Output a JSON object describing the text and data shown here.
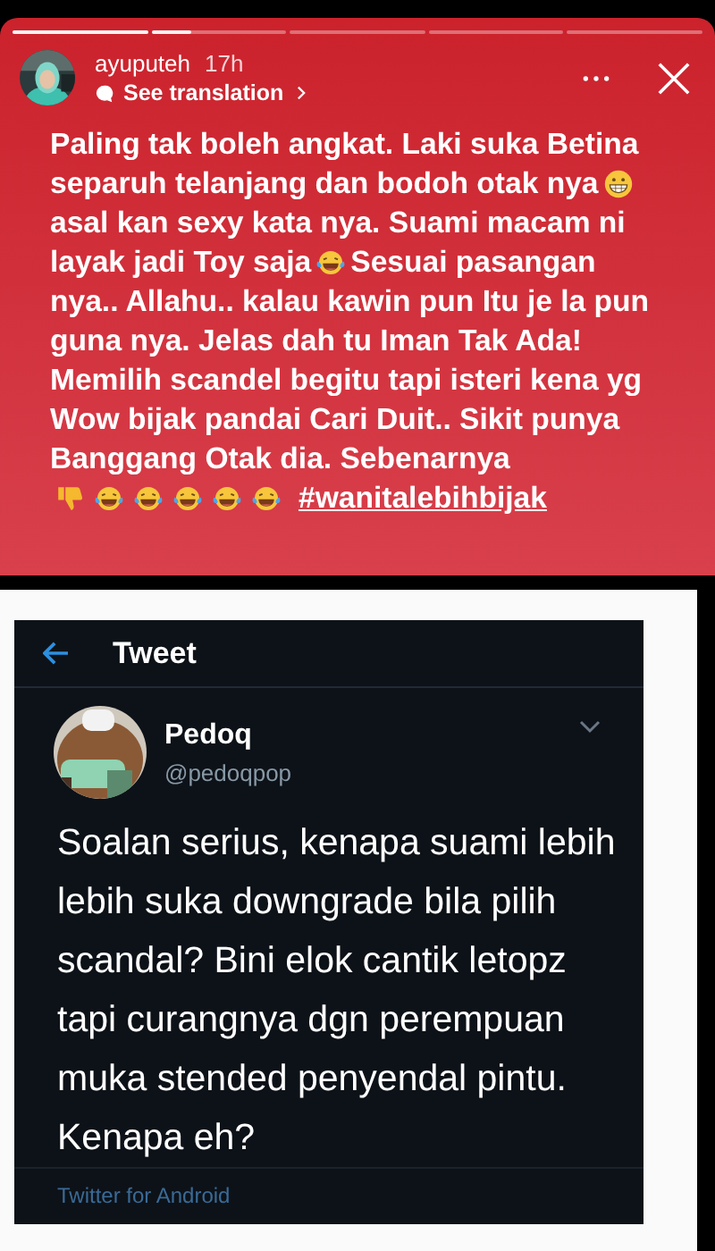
{
  "story": {
    "progress": [
      {
        "kind": "seen"
      },
      {
        "kind": "current",
        "level": 0.3
      },
      {
        "kind": "unseen"
      },
      {
        "kind": "unseen"
      },
      {
        "kind": "unseen"
      }
    ],
    "username": "ayuputeh",
    "time": "17h",
    "translation": "See translation",
    "caption_lines": [
      [
        {
          "kind": "text",
          "text": "Paling tak boleh angkat. Laki suka Betina"
        }
      ],
      [
        {
          "kind": "text",
          "text": "separuh telanjang dan bodoh otak nya"
        },
        {
          "kind": "grin"
        }
      ],
      [
        {
          "kind": "text",
          "text": "asal kan sexy kata nya. Suami macam ni"
        }
      ],
      [
        {
          "kind": "text",
          "text": "layak jadi Toy saja"
        },
        {
          "kind": "laugh"
        },
        {
          "kind": "text",
          "text": "Sesuai pasangan"
        }
      ],
      [
        {
          "kind": "text",
          "text": "nya.. Allahu.. kalau kawin pun Itu je la pun"
        }
      ],
      [
        {
          "kind": "text",
          "text": "guna nya. Jelas dah tu Iman Tak Ada!"
        }
      ],
      [
        {
          "kind": "text",
          "text": "Memilih scandel begitu tapi isteri kena yg"
        }
      ],
      [
        {
          "kind": "text",
          "text": "Wow bijak pandai  Cari  Duit.. Sikit punya"
        }
      ],
      [
        {
          "kind": "text",
          "text": "Banggang Otak dia. Sebenarnya"
        }
      ],
      [
        {
          "kind": "thumbsdown"
        },
        {
          "kind": "laugh"
        },
        {
          "kind": "laugh"
        },
        {
          "kind": "laugh"
        },
        {
          "kind": "laugh"
        },
        {
          "kind": "laugh"
        },
        {
          "kind": "hashtag",
          "text": "#wanitalebihbijak"
        }
      ]
    ]
  },
  "tweet": {
    "header": "Tweet",
    "name": "Pedoq",
    "handle": "@pedoqpop",
    "body_lines": [
      "Soalan serius, kenapa suami lebih",
      "lebih suka downgrade bila pilih",
      "scandal? Bini elok cantik letopz",
      "tapi curangnya dgn perempuan",
      "muka stended penyendal pintu.",
      "Kenapa eh?"
    ],
    "source": "Twitter for Android"
  }
}
